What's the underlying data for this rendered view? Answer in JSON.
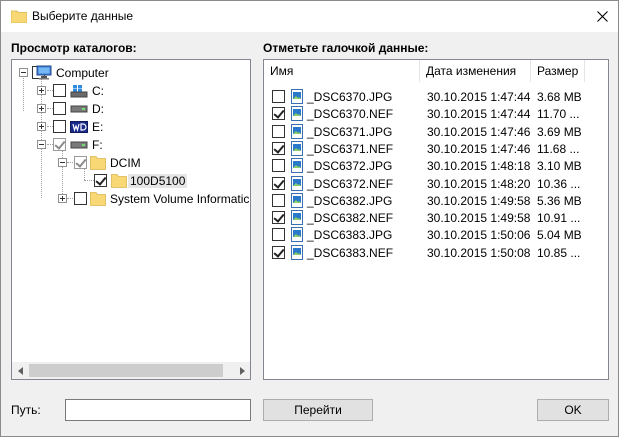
{
  "window": {
    "title": "Выберите данные"
  },
  "left": {
    "heading": "Просмотр каталогов:",
    "tree": [
      {
        "label": "Computer",
        "icon": "computer-icon",
        "checked": false,
        "expander": "minus"
      },
      {
        "label": "C:",
        "icon": "windows-drive-icon",
        "checked": false,
        "expander": "plus"
      },
      {
        "label": "D:",
        "icon": "drive-icon",
        "checked": false,
        "expander": "plus"
      },
      {
        "label": "E:",
        "icon": "wd-drive-icon",
        "checked": false,
        "expander": "plus"
      },
      {
        "label": "F:",
        "icon": "drive-icon",
        "checked": true,
        "expander": "minus"
      },
      {
        "label": "DCIM",
        "icon": "folder-icon",
        "checked": true,
        "expander": "minus"
      },
      {
        "label": "100D5100",
        "icon": "folder-icon",
        "checked": true,
        "expander": ""
      },
      {
        "label": "System Volume Informatic",
        "icon": "folder-icon",
        "checked": false,
        "expander": "plus"
      }
    ]
  },
  "right": {
    "heading": "Отметьте галочкой данные:",
    "columns": {
      "name": "Имя",
      "date": "Дата изменения",
      "size": "Размер"
    },
    "files": [
      {
        "name": "_DSC6370.JPG",
        "date": "30.10.2015 1:47:44",
        "size": "3.68 MB",
        "checked": false
      },
      {
        "name": "_DSC6370.NEF",
        "date": "30.10.2015 1:47:44",
        "size": "11.70 ...",
        "checked": true
      },
      {
        "name": "_DSC6371.JPG",
        "date": "30.10.2015 1:47:46",
        "size": "3.69 MB",
        "checked": false
      },
      {
        "name": "_DSC6371.NEF",
        "date": "30.10.2015 1:47:46",
        "size": "11.68 ...",
        "checked": true
      },
      {
        "name": "_DSC6372.JPG",
        "date": "30.10.2015 1:48:18",
        "size": "3.10 MB",
        "checked": false
      },
      {
        "name": "_DSC6372.NEF",
        "date": "30.10.2015 1:48:20",
        "size": "10.36 ...",
        "checked": true
      },
      {
        "name": "_DSC6382.JPG",
        "date": "30.10.2015 1:49:58",
        "size": "5.36 MB",
        "checked": false
      },
      {
        "name": "_DSC6382.NEF",
        "date": "30.10.2015 1:49:58",
        "size": "10.91 ...",
        "checked": true
      },
      {
        "name": "_DSC6383.JPG",
        "date": "30.10.2015 1:50:06",
        "size": "5.04 MB",
        "checked": false
      },
      {
        "name": "_DSC6383.NEF",
        "date": "30.10.2015 1:50:08",
        "size": "10.85 ...",
        "checked": true
      }
    ]
  },
  "bottom": {
    "path_label": "Путь:",
    "path_value": "",
    "go_button": "Перейти",
    "ok_button": "OK"
  },
  "colors": {
    "folder": "#f8d775",
    "window_bg": "#f0f0f0",
    "selection": "#e6e6e6"
  }
}
